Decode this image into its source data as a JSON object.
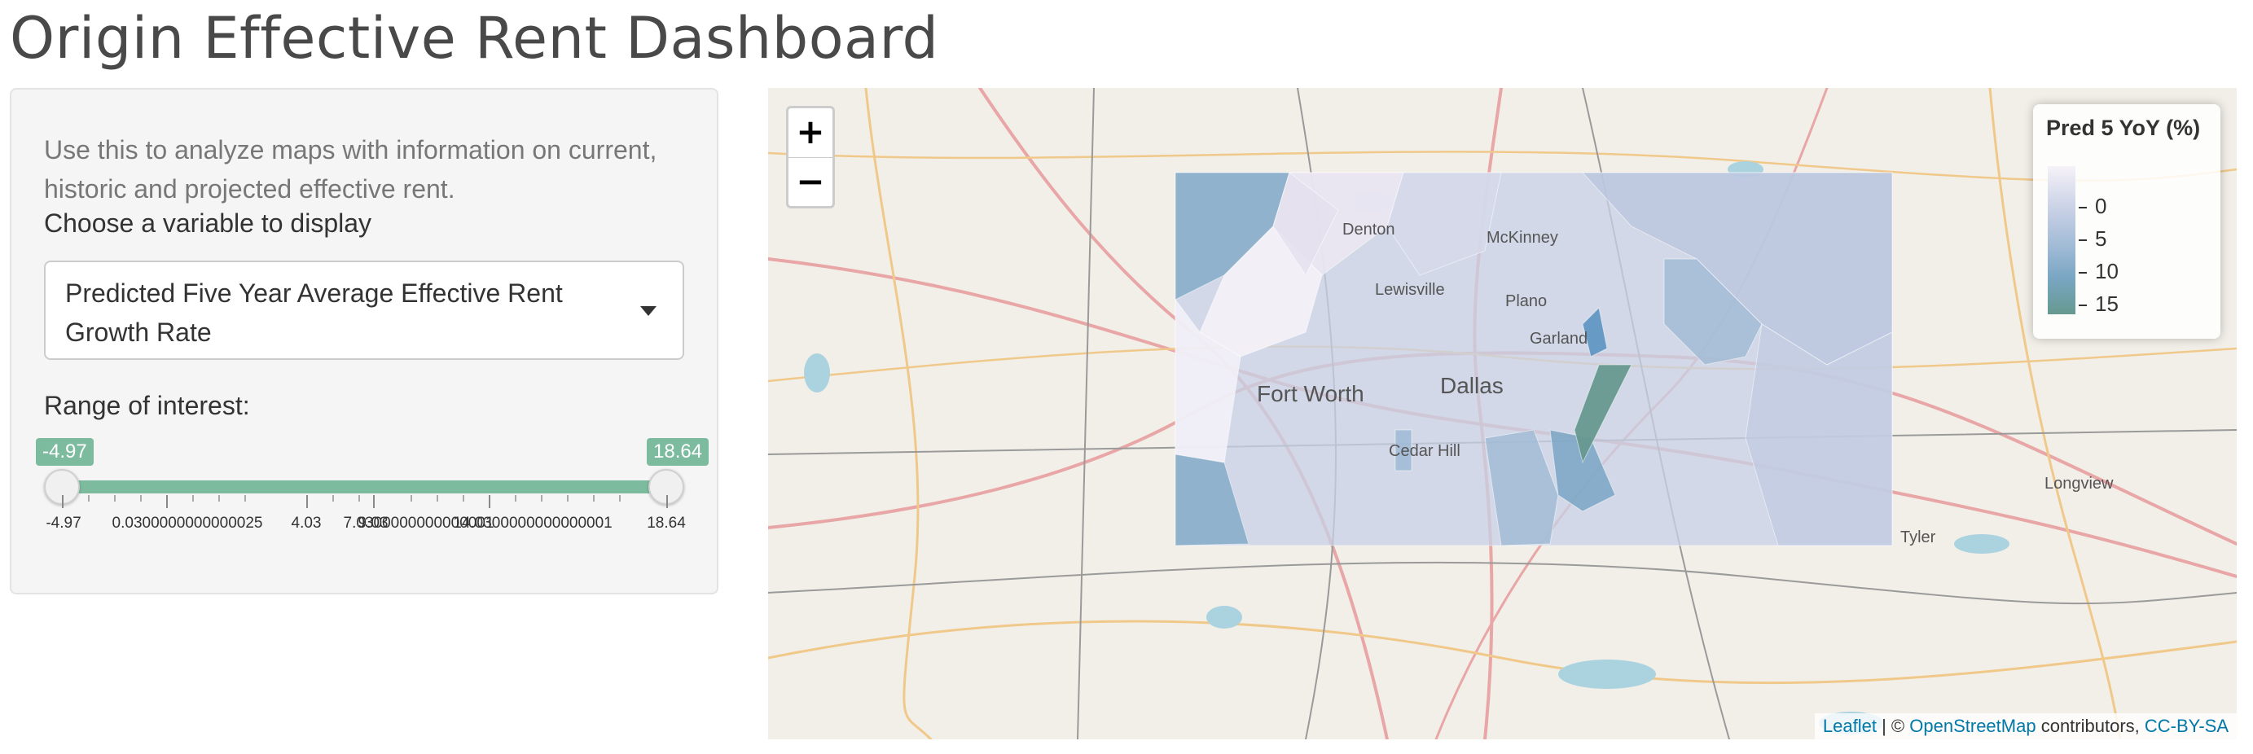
{
  "page": {
    "title": "Origin Effective Rent Dashboard"
  },
  "sidebar": {
    "description": "Use this to analyze maps with information on current, historic and projected effective rent.",
    "variable_label": "Choose a variable to display",
    "selected_variable": "Predicted Five Year Average Effective Rent Growth Rate",
    "range_label": "Range of interest:",
    "slider": {
      "min": -4.97,
      "max": 18.64,
      "value_low": -4.97,
      "value_high": 18.64,
      "min_label": "-4.97",
      "max_label": "18.64",
      "grid_labels": [
        "-4.97",
        "0.0300000000000025",
        "4.03",
        "9.03",
        "7.0300000000000001",
        "14.0300000000000001",
        "18.64"
      ]
    }
  },
  "map": {
    "zoom_in_label": "+",
    "zoom_out_label": "−",
    "cities": [
      "Denton",
      "McKinney",
      "Lewisville",
      "Plano",
      "Garland",
      "Fort Worth",
      "Dallas",
      "Cedar Hill",
      "Longview",
      "Tyler"
    ],
    "legend": {
      "title": "Pred 5 YoY (%)",
      "labels": [
        "0",
        "5",
        "10",
        "15"
      ],
      "colors": [
        "#f6f2f8",
        "#c7d0e5",
        "#7aa6c4",
        "#66998f"
      ]
    },
    "attribution": {
      "leaflet": "Leaflet",
      "separator": "| ©",
      "osm": "OpenStreetMap",
      "contributors": "contributors,",
      "license": "CC-BY-SA"
    }
  }
}
